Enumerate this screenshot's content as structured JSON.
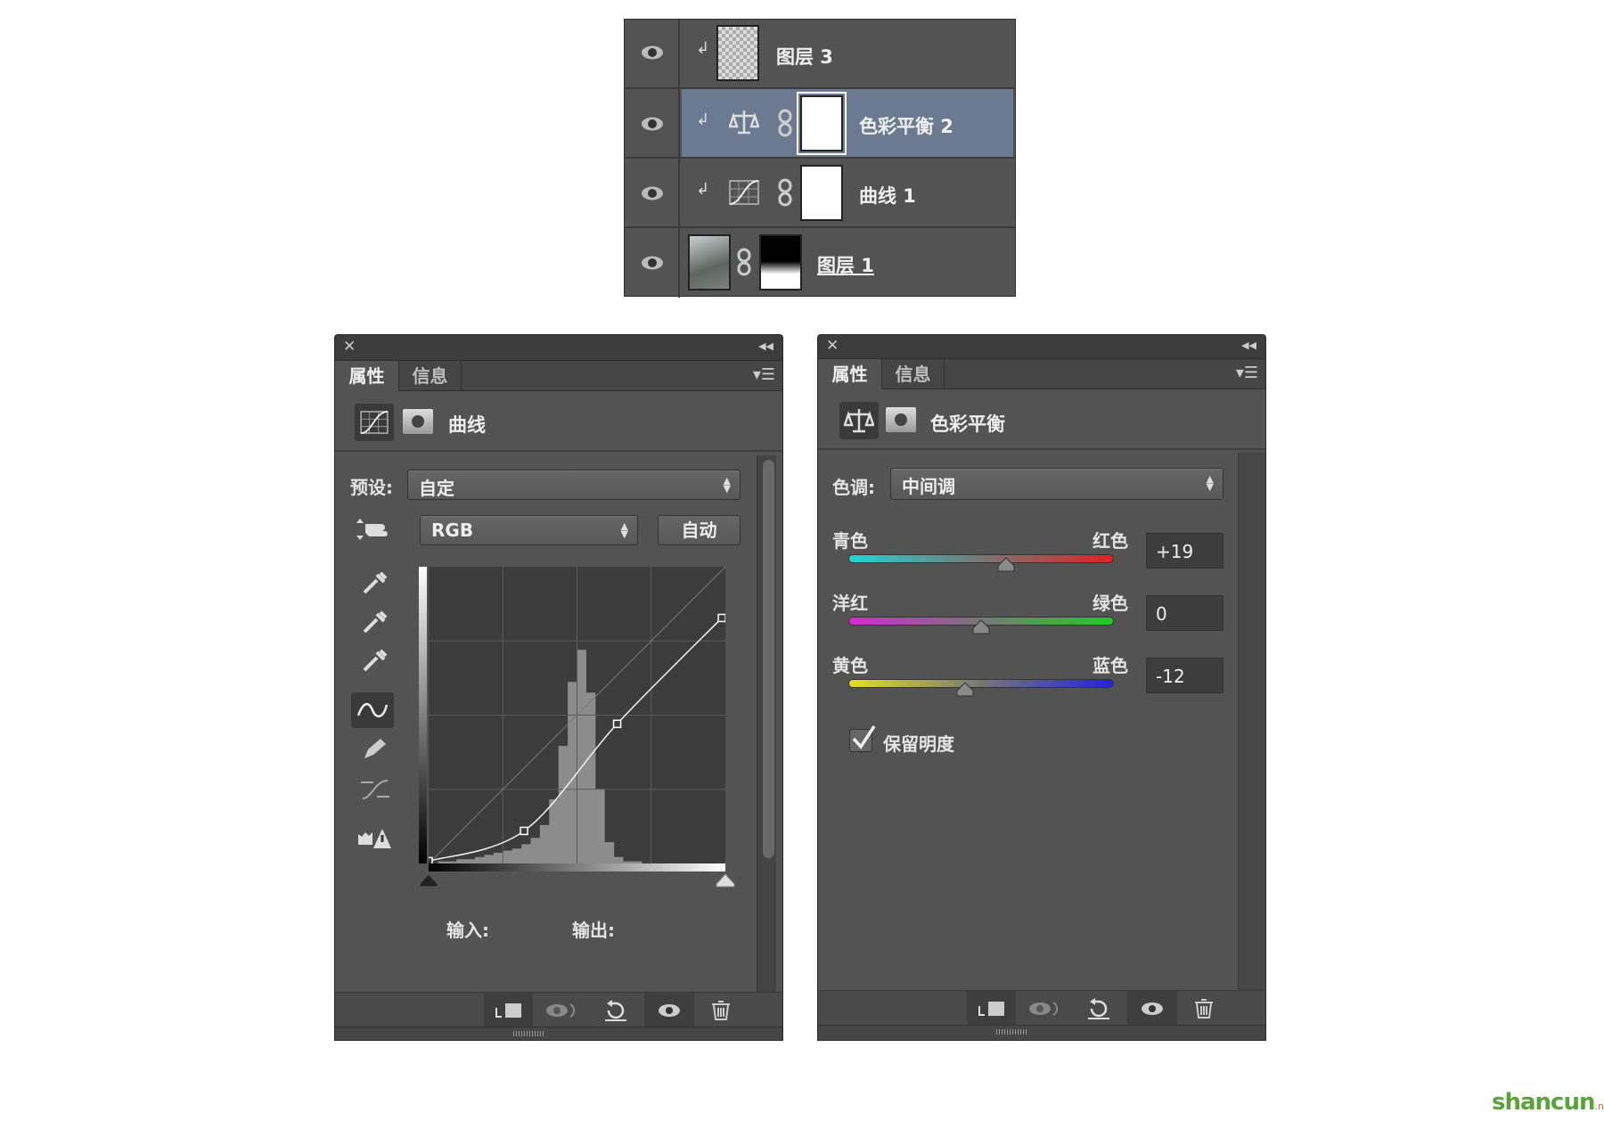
{
  "layers_panel": {
    "layers": [
      {
        "name": "图层 3",
        "type": "pixel",
        "clipped": true
      },
      {
        "name": "色彩平衡 2",
        "type": "color-balance",
        "clipped": true,
        "selected": true
      },
      {
        "name": "曲线 1",
        "type": "curves",
        "clipped": true
      },
      {
        "name": "图层 1",
        "type": "pixel-with-mask",
        "clipped": false
      }
    ],
    "selected_color": "#6b7a90"
  },
  "curves_panel": {
    "tabs": [
      "属性",
      "信息"
    ],
    "title": "曲线",
    "preset_label": "预设:",
    "preset_value": "自定",
    "channel": "RGB",
    "auto_label": "自动",
    "input_label": "输入:",
    "output_label": "输出:",
    "curve_points": [
      [
        0,
        2
      ],
      [
        82,
        28
      ],
      [
        162,
        120
      ],
      [
        252,
        211
      ]
    ],
    "histogram": [
      0,
      1,
      1,
      2,
      2,
      3,
      4,
      5,
      6,
      7,
      9,
      12,
      18,
      30,
      55,
      85,
      100,
      80,
      35,
      10,
      3,
      1,
      1,
      0,
      0,
      0,
      0,
      0,
      0,
      0,
      0,
      0
    ]
  },
  "color_balance_panel": {
    "tabs": [
      "属性",
      "信息"
    ],
    "title": "色彩平衡",
    "tone_label": "色调:",
    "tone_value": "中间调",
    "range": [
      -100,
      100
    ],
    "sliders": [
      {
        "left": "青色",
        "right": "红色",
        "value": "+19",
        "level": 19,
        "left_color": "#22d4d4",
        "right_color": "#e02222"
      },
      {
        "left": "洋红",
        "right": "绿色",
        "value": "0",
        "level": 0,
        "left_color": "#d42ad4",
        "right_color": "#22cc22"
      },
      {
        "left": "黄色",
        "right": "蓝色",
        "value": "-12",
        "level": -12,
        "left_color": "#e0e022",
        "right_color": "#2222e0"
      }
    ],
    "preserve_label": "保留明度",
    "preserve_checked": true
  },
  "watermark": {
    "text_main": "shancun",
    "text_sub": ".net"
  }
}
